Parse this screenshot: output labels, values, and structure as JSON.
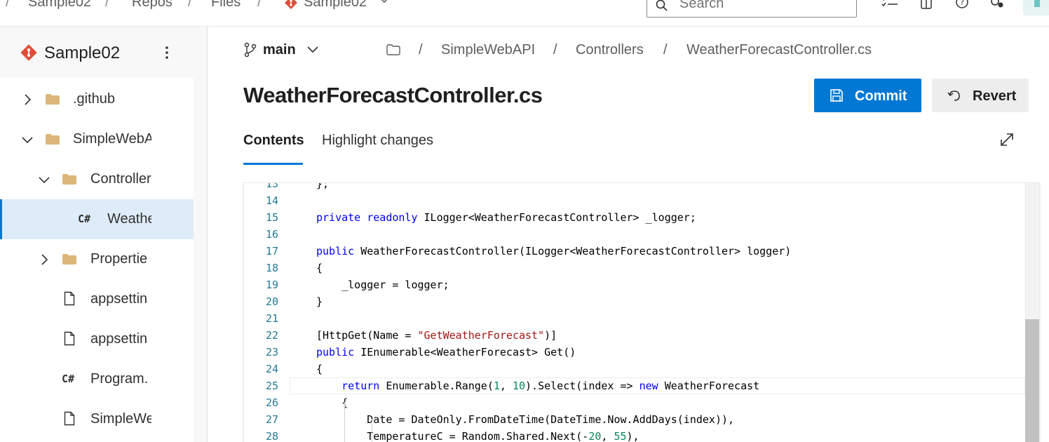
{
  "topbar": {
    "breadcrumb": [
      "Sample02",
      "Repos",
      "Files",
      "Sample02"
    ],
    "search_placeholder": "Search"
  },
  "sidebar": {
    "repo_name": "Sample02",
    "tree": [
      {
        "label": ".github",
        "type": "folder",
        "expanded": false,
        "level": 0
      },
      {
        "label": "SimpleWebA",
        "type": "folder",
        "expanded": true,
        "level": 0
      },
      {
        "label": "Controller",
        "type": "folder",
        "expanded": true,
        "level": 1
      },
      {
        "label": "Weathe",
        "type": "csharp",
        "selected": true,
        "level": 2,
        "glyph": "C#"
      },
      {
        "label": "Propertie",
        "type": "folder",
        "expanded": false,
        "level": 1
      },
      {
        "label": "appsettin",
        "type": "file",
        "level": 1
      },
      {
        "label": "appsettin",
        "type": "file",
        "level": 1
      },
      {
        "label": "Program.",
        "type": "csharp",
        "level": 1,
        "glyph": "C#"
      },
      {
        "label": "SimpleWe",
        "type": "file",
        "level": 1
      }
    ]
  },
  "main": {
    "branch": "main",
    "path": [
      "SimpleWebAPI",
      "Controllers",
      "WeatherForecastController.cs"
    ],
    "path_sep": "/",
    "title": "WeatherForecastController.cs",
    "commit_label": "Commit",
    "revert_label": "Revert",
    "tabs": [
      "Contents",
      "Highlight changes"
    ],
    "active_tab": "Contents"
  },
  "editor": {
    "current_line": 25,
    "lines": [
      {
        "n": "13",
        "code": "};"
      },
      {
        "n": "14",
        "code": ""
      },
      {
        "n": "15",
        "code": "private readonly ILogger<WeatherForecastController> _logger;"
      },
      {
        "n": "16",
        "code": ""
      },
      {
        "n": "17",
        "code": "public WeatherForecastController(ILogger<WeatherForecastController> logger)"
      },
      {
        "n": "18",
        "code": "{"
      },
      {
        "n": "19",
        "code": "    _logger = logger;"
      },
      {
        "n": "20",
        "code": "}"
      },
      {
        "n": "21",
        "code": ""
      },
      {
        "n": "22",
        "code": "[HttpGet(Name = \"GetWeatherForecast\")]"
      },
      {
        "n": "23",
        "code": "public IEnumerable<WeatherForecast> Get()"
      },
      {
        "n": "24",
        "code": "{"
      },
      {
        "n": "25",
        "code": "    return Enumerable.Range(1, 10).Select(index => new WeatherForecast"
      },
      {
        "n": "26",
        "code": "    {"
      },
      {
        "n": "27",
        "code": "        Date = DateOnly.FromDateTime(DateTime.Now.AddDays(index)),"
      },
      {
        "n": "28",
        "code": "        TemperatureC = Random.Shared.Next(-20, 55),"
      }
    ]
  },
  "colors": {
    "accent": "#0078d4",
    "keyword": "#0000ff",
    "string": "#a31515",
    "number": "#098658",
    "line_number": "#237893",
    "folder": "#dcb67a",
    "git_logo": "#e04e39"
  }
}
